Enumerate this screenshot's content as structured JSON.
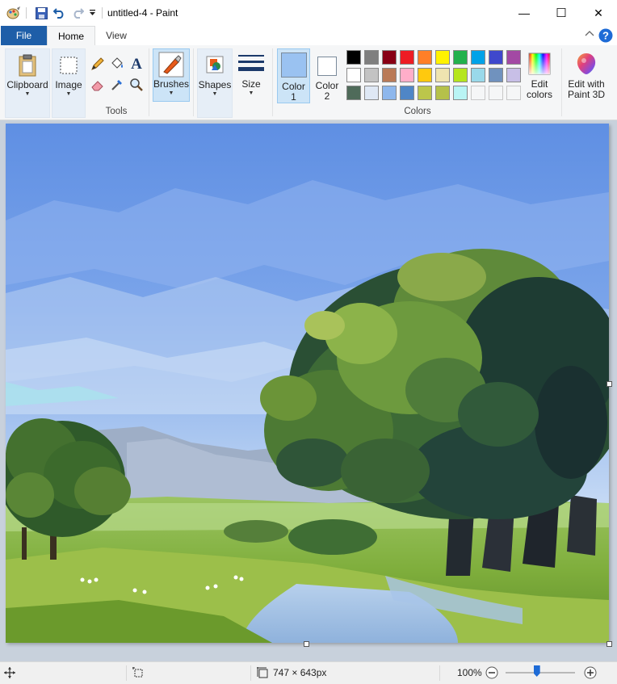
{
  "window": {
    "title": "untitled-4 - Paint",
    "minimize_glyph": "—",
    "maximize_glyph": "☐",
    "close_glyph": "✕"
  },
  "tabs": [
    {
      "label": "File"
    },
    {
      "label": "Home"
    },
    {
      "label": "View"
    }
  ],
  "ribbon": {
    "clipboard_label": "Clipboard",
    "image_label": "Image",
    "tools_label": "Tools",
    "brushes_label": "Brushes",
    "shapes_label": "Shapes",
    "size_label": "Size",
    "color1_label_a": "Color",
    "color1_label_b": "1",
    "color2_label_a": "Color",
    "color2_label_b": "2",
    "colors_group_label": "Colors",
    "edit_colors_a": "Edit",
    "edit_colors_b": "colors",
    "edit_paint3d_a": "Edit with",
    "edit_paint3d_b": "Paint 3D"
  },
  "palette": {
    "row1": [
      "#000000",
      "#7f7f7f",
      "#880015",
      "#ed1c24",
      "#ff7f27",
      "#fff200",
      "#22b14c",
      "#00a2e8",
      "#3f48cc",
      "#a349a4"
    ],
    "row2": [
      "#ffffff",
      "#c3c3c3",
      "#b97a57",
      "#ffaec9",
      "#ffc90e",
      "#efe4b0",
      "#b5e61d",
      "#99d9ea",
      "#7092be",
      "#c8bfe7"
    ],
    "row3": [
      "#4f6b5a",
      "#dfe8f5",
      "#8eb7ec",
      "#4f86c6",
      "#bcc64b",
      "#b5c14a",
      "#b9f4f4",
      "",
      "",
      ""
    ]
  },
  "colors": {
    "color1": "#9ac2f1",
    "color2": "#ffffff",
    "accent": "#1e5ea8",
    "help": "#1e6bd6"
  },
  "status": {
    "dimensions": "747 × 643px",
    "zoom": "100%"
  }
}
